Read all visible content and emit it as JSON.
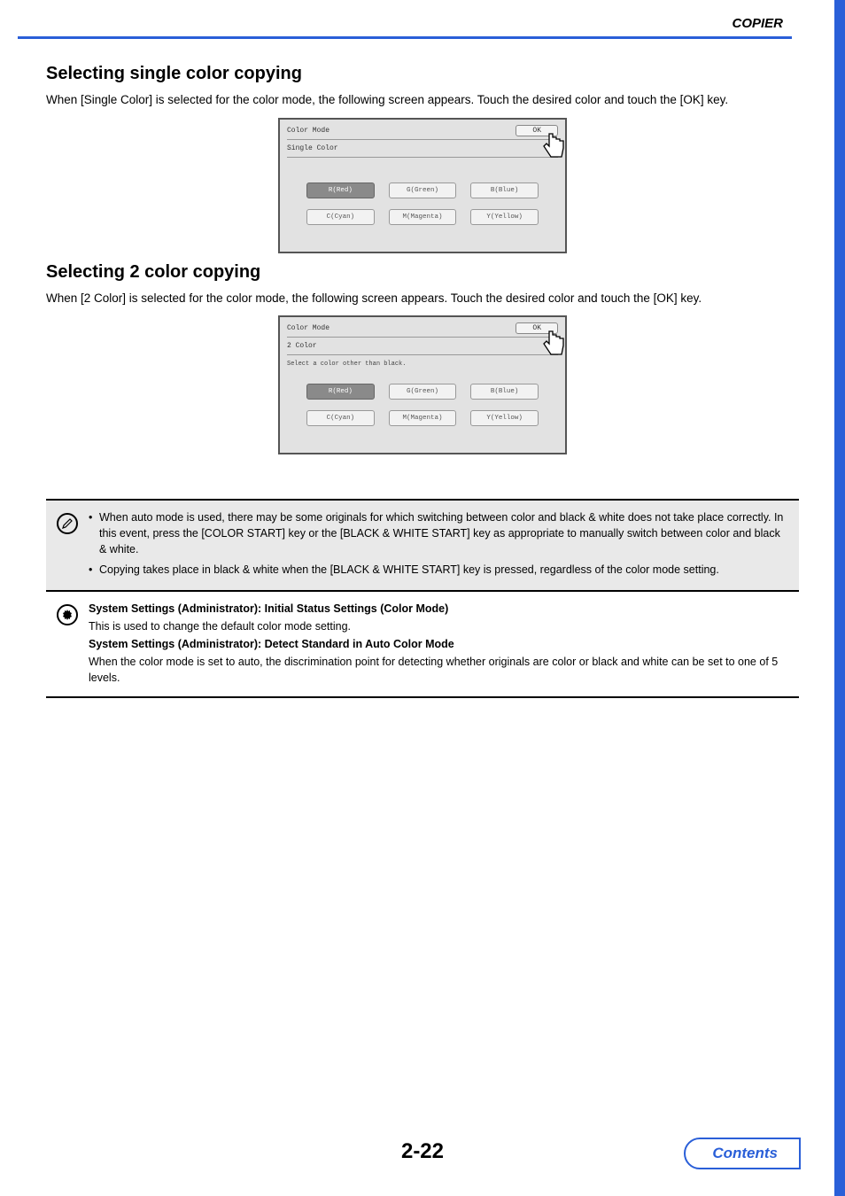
{
  "header": {
    "title": "COPIER"
  },
  "section1": {
    "heading": "Selecting single color copying",
    "body": "When [Single Color] is selected for the color mode, the following screen appears. Touch the desired color and touch the [OK] key."
  },
  "panel1": {
    "title": "Color Mode",
    "ok": "OK",
    "sub": "Single Color",
    "buttons": {
      "r": "R(Red)",
      "g": "G(Green)",
      "b": "B(Blue)",
      "c": "C(Cyan)",
      "m": "M(Magenta)",
      "y": "Y(Yellow)"
    }
  },
  "section2": {
    "heading": "Selecting 2 color copying",
    "body": "When [2 Color] is selected for the color mode, the following screen appears. Touch the desired color and touch the [OK] key."
  },
  "panel2": {
    "title": "Color Mode",
    "ok": "OK",
    "sub": "2 Color",
    "hint": "Select a color other than black.",
    "buttons": {
      "r": "R(Red)",
      "g": "G(Green)",
      "b": "B(Blue)",
      "c": "C(Cyan)",
      "m": "M(Magenta)",
      "y": "Y(Yellow)"
    }
  },
  "notes": {
    "n1": "When auto mode is used, there may be some originals for which switching between color and black & white does not take place correctly. In this event, press the [COLOR START] key or the [BLACK & WHITE START] key as appropriate to manually switch between color and black & white.",
    "n2": "Copying takes place in black & white when the [BLACK & WHITE START] key is pressed, regardless of the color mode setting."
  },
  "admin": {
    "t1": "System Settings (Administrator): Initial Status Settings (Color Mode)",
    "b1": "This is used to change the default color mode setting.",
    "t2": "System Settings (Administrator): Detect Standard in Auto Color Mode",
    "b2": "When the color mode is set to auto, the discrimination point for detecting whether originals are color or black and white can be set to one of 5 levels."
  },
  "footer": {
    "page": "2-22",
    "contents": "Contents"
  }
}
